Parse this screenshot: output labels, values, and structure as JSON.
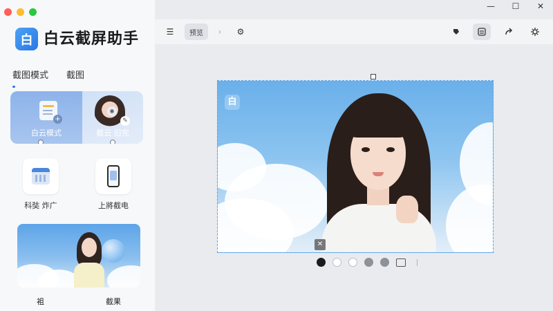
{
  "app": {
    "title": "白云截屏助手",
    "logo_text": "白"
  },
  "window_controls": {
    "minimize": "—",
    "maximize": "☐",
    "close": "✕"
  },
  "sidebar": {
    "tabs": [
      {
        "label": "截图模式",
        "active": true
      },
      {
        "label": "截图",
        "active": false
      }
    ],
    "mode_card": {
      "left_label": "白云模式",
      "right_label": "截云 旧完"
    },
    "tools": [
      {
        "label": "科奘 炸广",
        "icon": "calendar-icon"
      },
      {
        "label": "上將截电",
        "icon": "phone-icon"
      }
    ],
    "bottom_labels": [
      "袓",
      "截果"
    ]
  },
  "toolbar": {
    "list_icon": "☰",
    "preview_label": "预览",
    "chevron": "›",
    "node_icon": "⚙"
  },
  "canvas": {
    "logo_text": "白",
    "close_glyph": "✕"
  },
  "swatches": [
    "black",
    "white",
    "white",
    "gray",
    "gray"
  ],
  "colors": {
    "accent": "#2b76e4",
    "selection_border": "#5aa3e6"
  }
}
